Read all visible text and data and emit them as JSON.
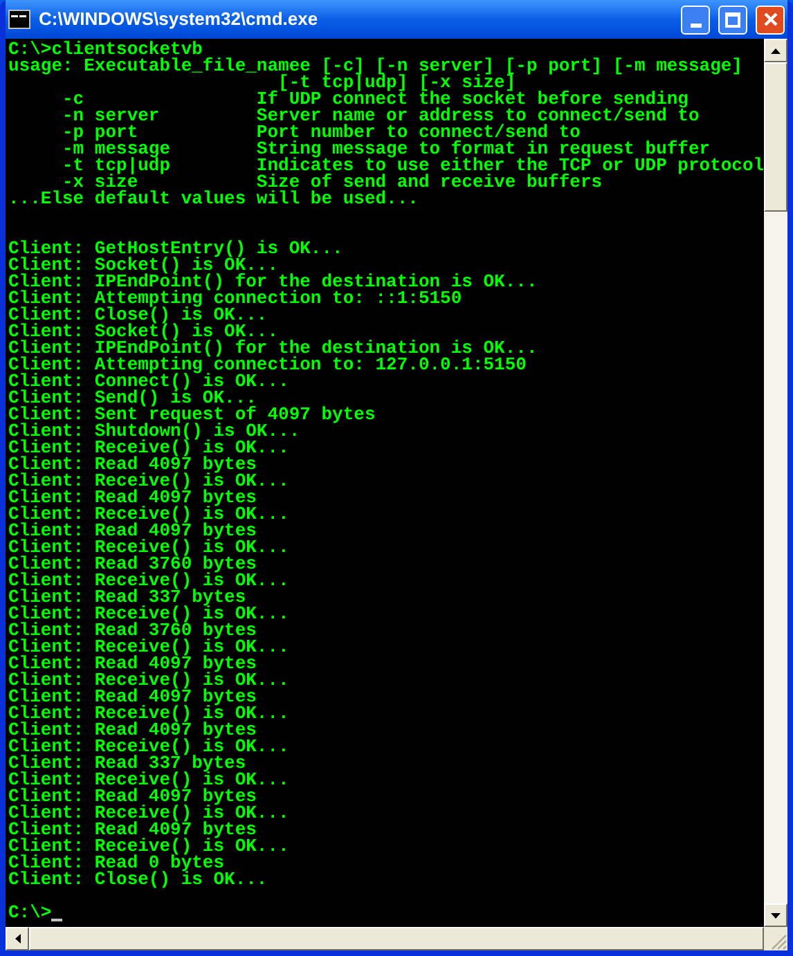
{
  "window": {
    "title": "C:\\WINDOWS\\system32\\cmd.exe"
  },
  "console": {
    "blocks": [
      [
        "C:\\>clientsocketvb",
        "usage: Executable_file_namee [-c] [-n server] [-p port] [-m message]",
        "                         [-t tcp|udp] [-x size]",
        "     -c                If UDP connect the socket before sending",
        "     -n server         Server name or address to connect/send to",
        "     -p port           Port number to connect/send to",
        "     -m message        String message to format in request buffer",
        "     -t tcp|udp        Indicates to use either the TCP or UDP protocol",
        "     -x size           Size of send and receive buffers",
        "...Else default values will be used..."
      ],
      [
        "Client: GetHostEntry() is OK...",
        "Client: Socket() is OK...",
        "Client: IPEndPoint() for the destination is OK...",
        "Client: Attempting connection to: ::1:5150",
        "Client: Close() is OK...",
        "Client: Socket() is OK...",
        "Client: IPEndPoint() for the destination is OK...",
        "Client: Attempting connection to: 127.0.0.1:5150",
        "Client: Connect() is OK...",
        "Client: Send() is OK...",
        "Client: Sent request of 4097 bytes",
        "Client: Shutdown() is OK...",
        "Client: Receive() is OK...",
        "Client: Read 4097 bytes",
        "Client: Receive() is OK...",
        "Client: Read 4097 bytes",
        "Client: Receive() is OK...",
        "Client: Read 4097 bytes",
        "Client: Receive() is OK...",
        "Client: Read 3760 bytes",
        "Client: Receive() is OK...",
        "Client: Read 337 bytes",
        "Client: Receive() is OK...",
        "Client: Read 3760 bytes",
        "Client: Receive() is OK...",
        "Client: Read 4097 bytes",
        "Client: Receive() is OK...",
        "Client: Read 4097 bytes",
        "Client: Receive() is OK...",
        "Client: Read 4097 bytes",
        "Client: Receive() is OK...",
        "Client: Read 337 bytes",
        "Client: Receive() is OK...",
        "Client: Read 4097 bytes",
        "Client: Receive() is OK...",
        "Client: Read 4097 bytes",
        "Client: Receive() is OK...",
        "Client: Read 0 bytes",
        "Client: Close() is OK..."
      ]
    ],
    "prompt": "C:\\>"
  }
}
